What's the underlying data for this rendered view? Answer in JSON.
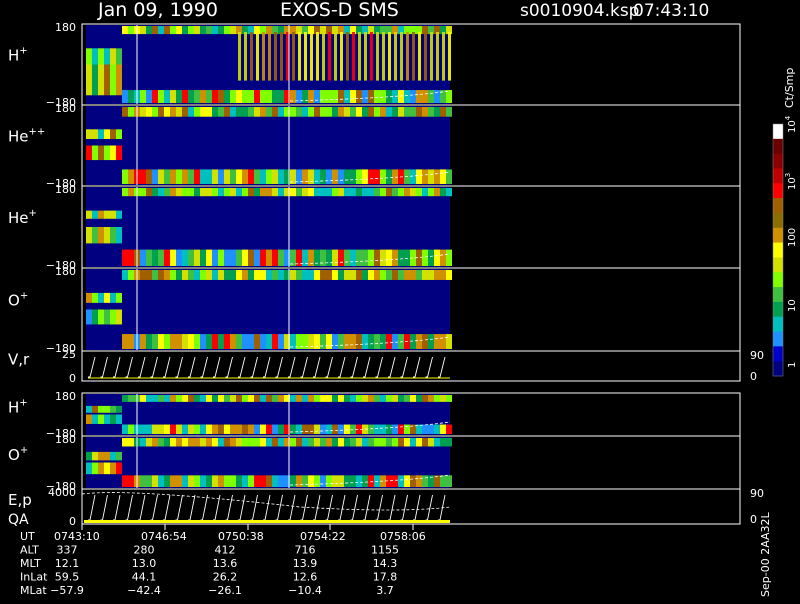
{
  "header": {
    "date": "Jan 09, 1990",
    "instrument": "EXOS-D SMS",
    "file": "s0010904.ksp",
    "time": "07:43:10"
  },
  "colorbar": {
    "unit": "Ct/Smp",
    "ticks": [
      "1",
      "10",
      "100",
      "10",
      "10",
      "10"
    ],
    "tick_exponents": [
      "",
      "",
      "",
      "3",
      "4",
      ""
    ],
    "colors": [
      "#000080",
      "#0000cd",
      "#1e90ff",
      "#00bfbf",
      "#00a050",
      "#40c040",
      "#7fff00",
      "#d4e000",
      "#ffff00",
      "#d09000",
      "#8b6d00",
      "#a06000",
      "#ff0000",
      "#c00000",
      "#8b0000",
      "#6b0000",
      "#ffffff"
    ]
  },
  "footer_stamp": "Sep-00 2AA32L",
  "chart_data": {
    "type": "heatmap",
    "time_range": [
      "07:43:10",
      "08:00:00"
    ],
    "panels": [
      {
        "label": "H",
        "sup": "+",
        "ymax": "180",
        "ymin": "−180",
        "kind": "pitch",
        "mode": "fat"
      },
      {
        "label": "He",
        "sup": "++",
        "ymax": "180",
        "ymin": "−180",
        "kind": "pitch",
        "mode": "thin"
      },
      {
        "label": "He",
        "sup": "+",
        "ymax": "180",
        "ymin": "−180",
        "kind": "pitch",
        "mode": "med"
      },
      {
        "label": "O",
        "sup": "+",
        "ymax": "180",
        "ymin": "−180",
        "kind": "pitch",
        "mode": "o"
      },
      {
        "label": "V,r",
        "sup": "",
        "ymax": "25",
        "ymin": "0",
        "kind": "line",
        "right_top": "90",
        "right_bottom": "0"
      },
      {
        "label": "H",
        "sup": "+",
        "ymax": "180",
        "ymin": "−180",
        "kind": "pitch",
        "mode": "small"
      },
      {
        "label": "O",
        "sup": "+",
        "ymax": "180",
        "ymin": "−180",
        "kind": "pitch",
        "mode": "small"
      },
      {
        "label": "E,p",
        "label2": "QA",
        "sup": "",
        "ymax": "4000",
        "ymin": "0",
        "kind": "line",
        "right_top": "90",
        "right_bottom": "0"
      }
    ],
    "ephemeris": {
      "rows": [
        {
          "name": "UT",
          "values": [
            "0743:10",
            "0746:54",
            "0750:38",
            "0754:22",
            "0758:06"
          ]
        },
        {
          "name": "ALT",
          "values": [
            "337",
            "280",
            "412",
            "716",
            "1155"
          ]
        },
        {
          "name": "MLT",
          "values": [
            "12.1",
            "13.0",
            "13.6",
            "13.9",
            "14.3"
          ]
        },
        {
          "name": "InLat",
          "values": [
            "59.5",
            "44.1",
            "26.2",
            "12.6",
            "17.8"
          ]
        },
        {
          "name": "MLat",
          "values": [
            "−57.9",
            "−42.4",
            "−26.1",
            "−10.4",
            "3.7"
          ]
        }
      ]
    }
  }
}
